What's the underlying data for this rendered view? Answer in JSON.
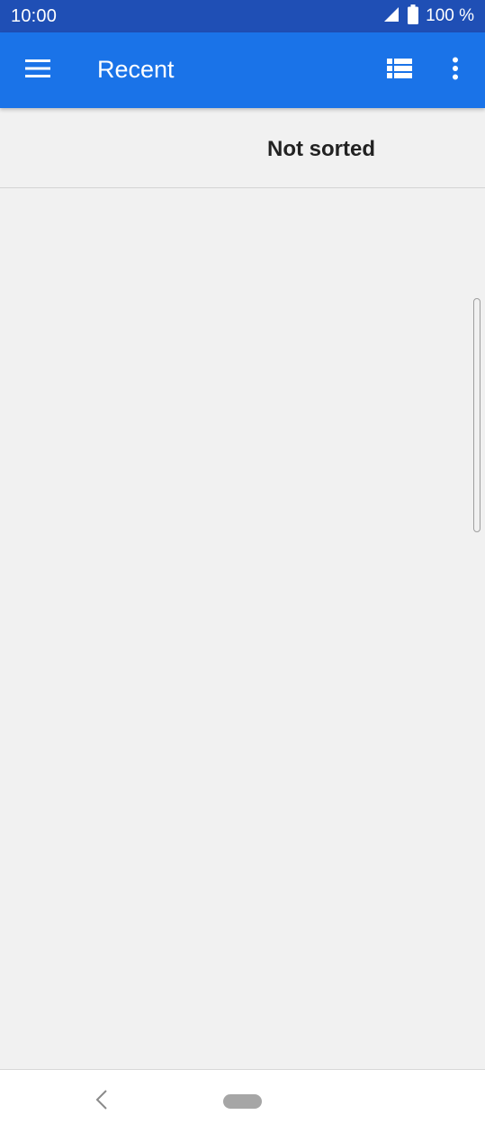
{
  "status_bar": {
    "time": "10:00",
    "battery_text": "100 %",
    "icons": [
      "signal-icon",
      "battery-icon"
    ]
  },
  "app_bar": {
    "title": "Recent",
    "icons": [
      "menu-icon",
      "list-view-icon",
      "more-vert-icon"
    ],
    "color": "#1a73e8"
  },
  "sort_bar": {
    "label": "Not sorted"
  },
  "nav_bar": {
    "icons": [
      "back-icon",
      "home-pill-icon"
    ]
  },
  "colors": {
    "status_bar": "#1f4fb5",
    "app_bar": "#1a73e8",
    "background": "#f1f1f1"
  }
}
